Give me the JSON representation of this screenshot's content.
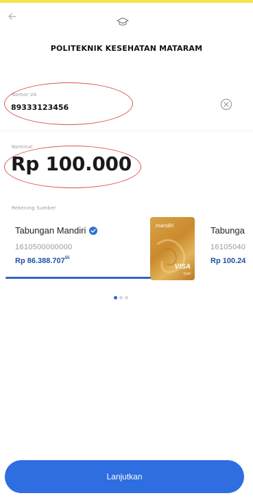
{
  "header": {
    "title": "POLITEKNIK KESEHATAN MATARAM",
    "back_icon": "arrow-left-icon",
    "cap_icon": "graduation-cap-icon"
  },
  "fields": {
    "number_label": "Nomor VA",
    "number_value": "89333123456",
    "amount_label": "Nominal",
    "amount_value": "Rp 100.000",
    "source_label": "Rekening Sumber"
  },
  "accounts": [
    {
      "name": "Tabungan Mandiri",
      "number": "1610500000000",
      "balance": "Rp 86.388.707",
      "balance_cents": "55",
      "verified": true
    },
    {
      "name": "Tabunga",
      "number": "16105040",
      "balance": "Rp 100.24"
    }
  ],
  "bank_card": {
    "brand": "mandiri",
    "network": "VISA",
    "network_sub": "Gold"
  },
  "pager": {
    "total": 3,
    "active": 0
  },
  "cta": {
    "label": "Lanjutkan"
  },
  "colors": {
    "accent": "#2f6ee0",
    "balance": "#1e4fa6",
    "annotation": "#d9534f",
    "topline": "#f6e24a"
  }
}
